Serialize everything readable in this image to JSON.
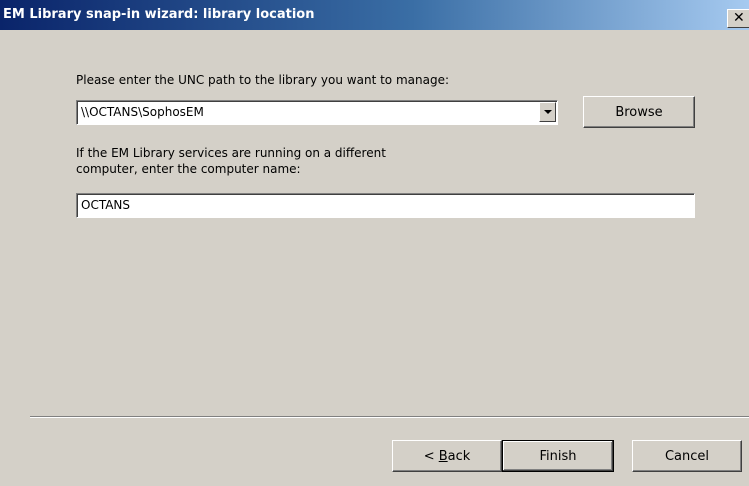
{
  "window": {
    "title": "EM Library snap-in wizard: library location",
    "close_glyph": "✕"
  },
  "form": {
    "unc_label": "Please enter the UNC path to the library you want to manage:",
    "unc_value": "\\\\OCTANS\\SophosEM",
    "browse_label": "Browse",
    "computer_label_line1": "If the EM Library services are running on a different",
    "computer_label_line2": "computer, enter the computer name:",
    "computer_value": "OCTANS"
  },
  "footer": {
    "back_prefix": "< ",
    "back_mnemonic": "B",
    "back_rest": "ack",
    "finish_label": "Finish",
    "cancel_label": "Cancel"
  }
}
